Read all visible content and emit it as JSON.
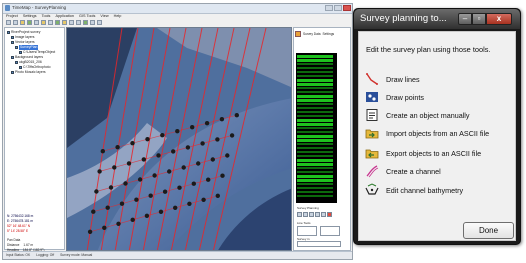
{
  "app": {
    "title": "TimeMap - SurveyPlanning",
    "menus": [
      "Project",
      "Settings",
      "Tools",
      "Application",
      "GIS Tools",
      "View",
      "Help"
    ],
    "toolbar_icons": [
      "new-icon",
      "open-icon",
      "save-icon",
      "print-icon",
      "zoom-in-icon",
      "zoom-out-icon",
      "pan-icon",
      "select-icon",
      "measure-icon",
      "layer-icon",
      "grid-icon",
      "info-icon",
      "settings-icon",
      "help-icon"
    ]
  },
  "project_tree": {
    "items": [
      {
        "label": "RiverProject survey",
        "indent": 0,
        "selected": false
      },
      {
        "label": "Image layers",
        "indent": 1,
        "selected": false
      },
      {
        "label": "Vector layers",
        "indent": 1,
        "selected": false
      },
      {
        "label": "SurveyPlan",
        "indent": 2,
        "selected": true
      },
      {
        "label": "C:\\Users\\TempObject",
        "indent": 3,
        "selected": false
      },
      {
        "label": "Background layers",
        "indent": 1,
        "selected": false
      },
      {
        "label": "ukgB2015_206",
        "indent": 2,
        "selected": false
      },
      {
        "label": "C:\\TiffsOrthophoto",
        "indent": 3,
        "selected": false
      },
      {
        "label": "Photo Mosaic layers",
        "indent": 1,
        "selected": false
      }
    ],
    "coords": [
      {
        "text": "N: 2756432.168 m",
        "color": "blue"
      },
      {
        "text": "E: 2756478.181 m",
        "color": "blue"
      },
      {
        "text": "52° 16' 48.61\" N",
        "color": "red"
      },
      {
        "text": "5° 14' 28.58\" E",
        "color": "red"
      }
    ],
    "footer": [
      {
        "label": "Pan Data",
        "value": ""
      },
      {
        "label": "Distance",
        "value": "1.67 m"
      },
      {
        "label": "Heading",
        "value": "184.8° (182.9°)"
      }
    ]
  },
  "statusbar": {
    "items": [
      "Input Status: OK",
      "Logging: Off",
      "Survey mode: Manual"
    ]
  },
  "right_panel": {
    "header": [
      "Survey Data",
      "Settings",
      "Lines"
    ],
    "nav_labels": [
      "Survey Planning",
      "Line Tools",
      "Advanced",
      "Survey in",
      "Survey Ob..",
      "Settings"
    ]
  },
  "tool_window": {
    "title": "Survey planning to...",
    "controls": {
      "minimize": "–",
      "maximize": "▫",
      "close": "x"
    },
    "description": "Edit the survey plan using those tools.",
    "tools": [
      {
        "icon": "draw-lines-icon",
        "label": "Draw lines"
      },
      {
        "icon": "draw-points-icon",
        "label": "Draw points"
      },
      {
        "icon": "create-object-icon",
        "label": "Create an object manually"
      },
      {
        "icon": "import-folder-icon",
        "label": "Import objects from an ASCII file"
      },
      {
        "icon": "export-folder-icon",
        "label": "Export objects to an ASCII file"
      },
      {
        "icon": "create-channel-icon",
        "label": "Create a channel"
      },
      {
        "icon": "channel-bathymetry-icon",
        "label": "Edit channel bathymetry"
      }
    ],
    "done_label": "Done"
  },
  "map": {
    "survey_line_color": "#e8262a",
    "point_color": "#1a1a1a"
  }
}
